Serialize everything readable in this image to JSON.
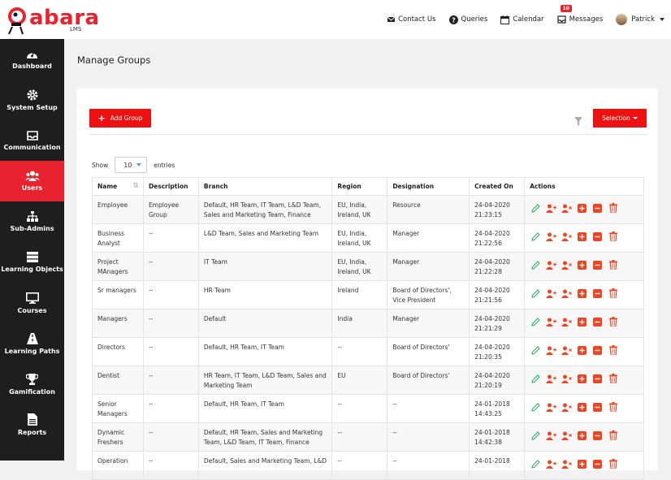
{
  "app": {
    "logo_text": "abara",
    "logo_sub": "LMS"
  },
  "topnav": {
    "contact": "Contact Us",
    "queries": "Queries",
    "calendar": "Calendar",
    "messages": "Messages",
    "messages_badge": "10",
    "user": "Patrick"
  },
  "sidebar": {
    "items": [
      {
        "label": "Dashboard",
        "icon": "dashboard-icon"
      },
      {
        "label": "System Setup",
        "icon": "gear-icon"
      },
      {
        "label": "Communication",
        "icon": "inbox-icon"
      },
      {
        "label": "Users",
        "icon": "users-icon",
        "active": true
      },
      {
        "label": "Sub-Admins",
        "icon": "sitemap-icon"
      },
      {
        "label": "Learning Objects",
        "icon": "server-icon"
      },
      {
        "label": "Courses",
        "icon": "monitor-icon"
      },
      {
        "label": "Learning Paths",
        "icon": "path-icon"
      },
      {
        "label": "Gamification",
        "icon": "trophy-icon"
      },
      {
        "label": "Reports",
        "icon": "report-icon"
      }
    ]
  },
  "page": {
    "title": "Manage Groups"
  },
  "toolbar": {
    "add_label": "Add Group",
    "selection_label": "Selection"
  },
  "entries": {
    "show": "Show",
    "value": "10",
    "entries": "entries"
  },
  "table": {
    "headers": [
      "Name",
      "Description",
      "Branch",
      "Region",
      "Designation",
      "Created On",
      "Actions"
    ],
    "rows": [
      [
        "Employee",
        "Employee Group",
        "Default, HR Team, IT Team, L&D Team, Sales and Marketing Team, Finance",
        "EU, India, Ireland, UK",
        "Resource",
        "24-04-2020 21:23:15"
      ],
      [
        "Business Analyst",
        "--",
        "L&D Team, Sales and Marketing Team",
        "EU, India, Ireland, UK",
        "Manager",
        "24-04-2020 21:22:56"
      ],
      [
        "Project MAnagers",
        "--",
        "IT Team",
        "EU, India, Ireland, UK",
        "Manager",
        "24-04-2020 21:22:28"
      ],
      [
        "Sr managers",
        "--",
        "HR Team",
        "Ireland",
        "Board of Directors', Vice President",
        "24-04-2020 21:21:56"
      ],
      [
        "Managers",
        "--",
        "Default",
        "India",
        "Manager",
        "24-04-2020 21:21:29"
      ],
      [
        "Directors",
        "--",
        "Default, HR Team, IT Team",
        "--",
        "Board of Directors'",
        "24-04-2020 21:20:35"
      ],
      [
        "Dentist",
        "--",
        "HR Team, IT Team, L&D Team, Sales and Marketing Team",
        "EU",
        "Board of Directors'",
        "24-04-2020 21:20:19"
      ],
      [
        "Senior Managers",
        "--",
        "Default, HR Team, IT Team",
        "--",
        "--",
        "24-01-2018 14:43:25"
      ],
      [
        "Dynamic Freshers",
        "--",
        "Default, HR Team, Sales and Marketing Team, L&D Team, IT Team, Finance",
        "--",
        "--",
        "24-01-2018 14:42:38"
      ],
      [
        "Operation",
        "--",
        "Default, Sales and Marketing Team, L&D",
        "--",
        "--",
        "24-01-2018"
      ]
    ]
  },
  "colors": {
    "accent": "#e8222e",
    "sidebar": "#1e1e1e",
    "edit": "#3cb371",
    "action": "#ee4422"
  }
}
